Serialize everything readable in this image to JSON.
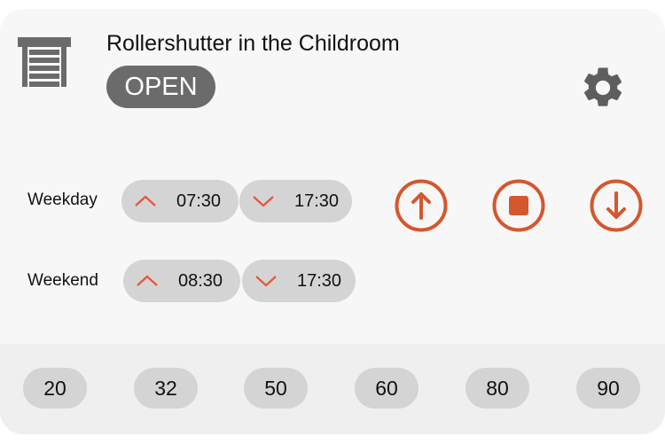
{
  "device": {
    "title": "Rollershutter in the Childroom",
    "state": "OPEN",
    "icon": "rollershutter-icon"
  },
  "schedule": [
    {
      "label": "Weekday",
      "up": "07:30",
      "down": "17:30"
    },
    {
      "label": "Weekend",
      "up": "08:30",
      "down": "17:30"
    }
  ],
  "controls": [
    "up",
    "stop",
    "down"
  ],
  "positions": [
    "20",
    "32",
    "50",
    "60",
    "80",
    "90"
  ],
  "colors": {
    "accent": "#d4572e",
    "chevron": "#e8533a",
    "badge": "#6b6b6b",
    "chip": "#d4d4d4"
  }
}
